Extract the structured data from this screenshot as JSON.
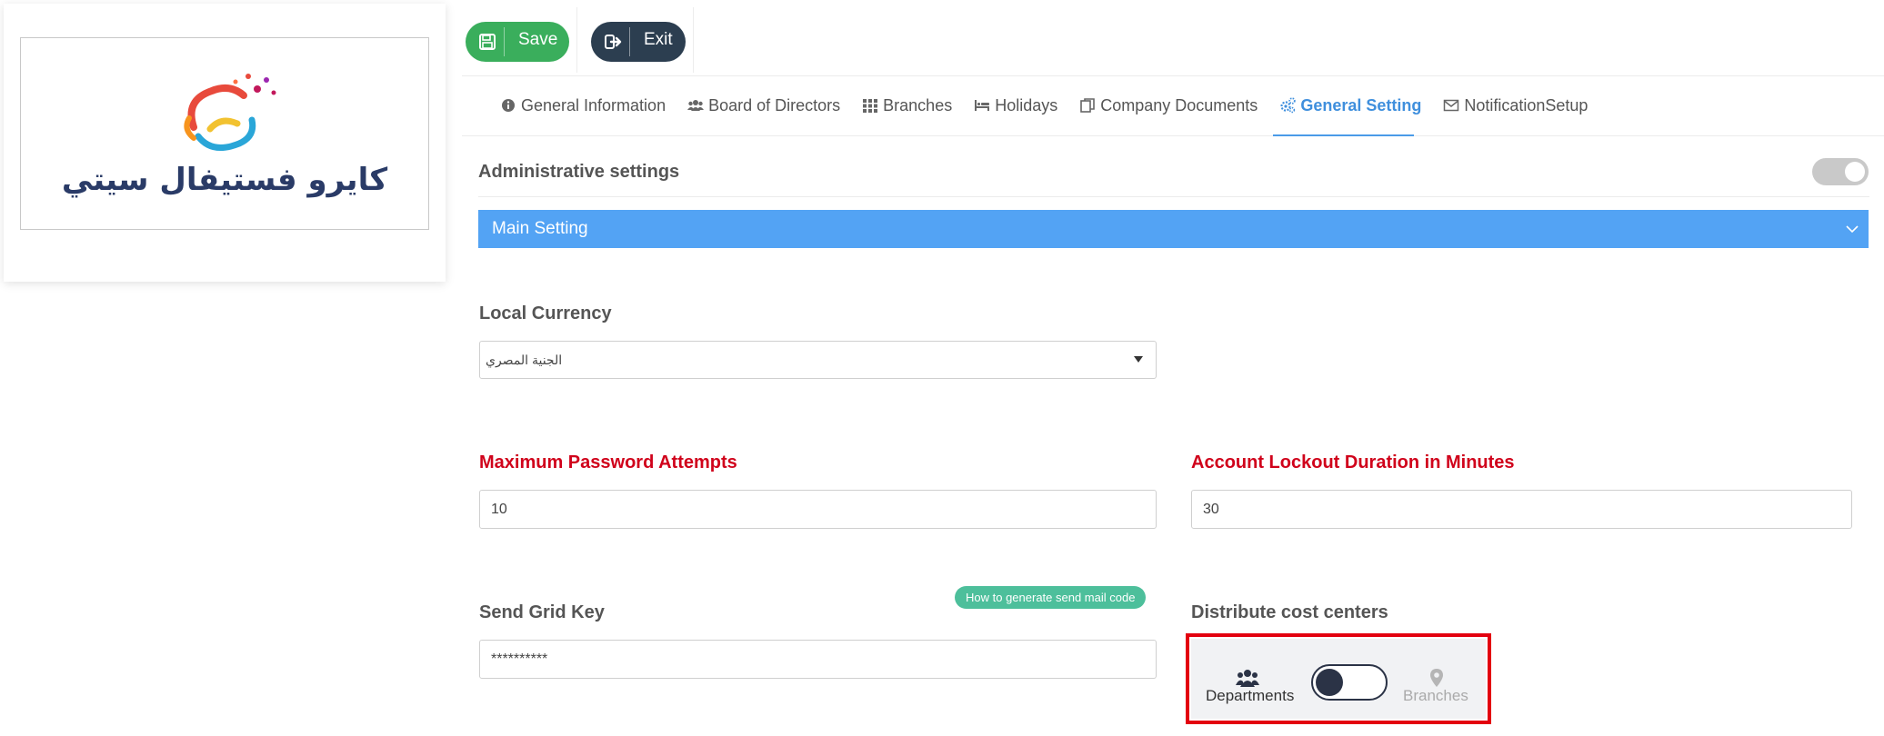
{
  "logo": {
    "text": "كايرو فستيفال سيتي"
  },
  "toolbar": {
    "save_label": "Save",
    "exit_label": "Exit"
  },
  "tabs": [
    {
      "label": "General Information",
      "icon": "info-circle-icon"
    },
    {
      "label": "Board of Directors",
      "icon": "users-icon"
    },
    {
      "label": "Branches",
      "icon": "grid-icon"
    },
    {
      "label": "Holidays",
      "icon": "bed-icon"
    },
    {
      "label": "Company Documents",
      "icon": "documents-icon"
    },
    {
      "label": "General Setting",
      "icon": "gears-icon",
      "active": true
    },
    {
      "label": "NotificationSetup",
      "icon": "envelope-icon"
    }
  ],
  "admin": {
    "title": "Administrative settings",
    "enabled": true
  },
  "main_setting": {
    "label": "Main Setting"
  },
  "currency": {
    "label": "Local Currency",
    "value": "الجنية المصري"
  },
  "max_password": {
    "label": "Maximum Password Attempts",
    "value": "10"
  },
  "lockout": {
    "label": "Account Lockout Duration in Minutes",
    "value": "30"
  },
  "sendgrid": {
    "label": "Send Grid Key",
    "value": "**********",
    "help_label": "How to generate send mail code"
  },
  "distribute": {
    "label": "Distribute cost centers",
    "left_option": "Departments",
    "right_option": "Branches"
  },
  "colors": {
    "save": "#3aae5c",
    "exit": "#2c3e50",
    "accent": "#53a3f4",
    "required": "#d0021b",
    "help_pill": "#4dbf9b",
    "highlight": "#e3000f"
  }
}
